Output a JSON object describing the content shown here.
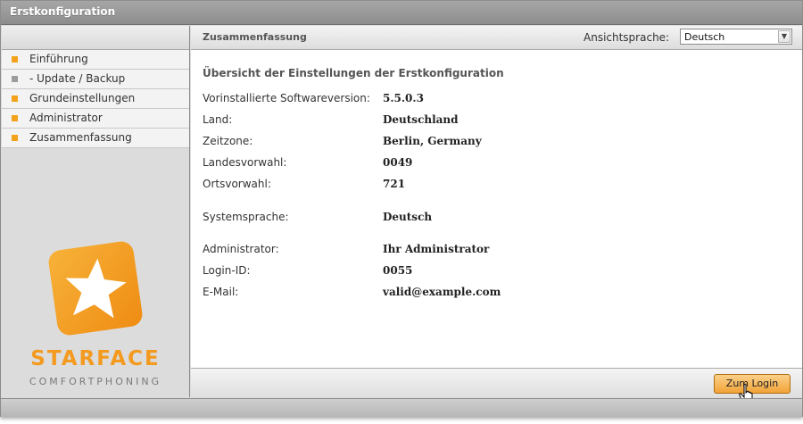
{
  "window": {
    "title": "Erstkonfiguration"
  },
  "sidebar": {
    "items": [
      {
        "label": "Einführung",
        "state": "active"
      },
      {
        "label": "- Update / Backup",
        "state": "inactive"
      },
      {
        "label": "Grundeinstellungen",
        "state": "active"
      },
      {
        "label": "Administrator",
        "state": "active"
      },
      {
        "label": "Zusammenfassung",
        "state": "active"
      }
    ],
    "brand": "STARFACE",
    "slogan": "COMFORTPHONING"
  },
  "header": {
    "section_title": "Zusammenfassung",
    "view_language_label": "Ansichtsprache:",
    "view_language_value": "Deutsch"
  },
  "summary": {
    "heading": "Übersicht der Einstellungen der Erstkonfiguration",
    "rows": [
      {
        "label": "Vorinstallierte Softwareversion:",
        "value": "5.5.0.3"
      },
      {
        "label": "Land:",
        "value": "Deutschland"
      },
      {
        "label": "Zeitzone:",
        "value": "Berlin, Germany"
      },
      {
        "label": "Landesvorwahl:",
        "value": "0049"
      },
      {
        "label": "Ortsvorwahl:",
        "value": "721"
      },
      {
        "label": "Systemsprache:",
        "value": "Deutsch"
      },
      {
        "label": "Administrator:",
        "value": "Ihr Administrator"
      },
      {
        "label": "Login-ID:",
        "value": "0055"
      },
      {
        "label": "E-Mail:",
        "value": "valid@example.com"
      }
    ]
  },
  "footer": {
    "login_button": "Zum Login"
  },
  "colors": {
    "accent": "#f2a21b",
    "brand": "#f39a1f",
    "inactive_bullet": "#9c9c9c"
  }
}
